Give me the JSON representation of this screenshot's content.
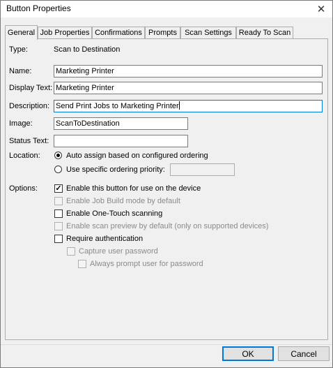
{
  "window": {
    "title": "Button Properties",
    "close_glyph": "✕"
  },
  "tabs": [
    {
      "label": "General",
      "active": true
    },
    {
      "label": "Job Properties"
    },
    {
      "label": "Confirmations"
    },
    {
      "label": "Prompts"
    },
    {
      "label": "Scan Settings"
    },
    {
      "label": "Ready To Scan"
    }
  ],
  "general": {
    "type_label": "Type:",
    "type_value": "Scan to Destination",
    "name_label": "Name:",
    "name_value": "Marketing Printer",
    "display_label": "Display Text:",
    "display_value": "Marketing Printer",
    "description_label": "Description:",
    "description_value": "Send Print Jobs to Marketing Printer",
    "image_label": "Image:",
    "image_value": "ScanToDestination",
    "status_label": "Status Text:",
    "status_value": "",
    "location_label": "Location:",
    "location_auto": "Auto assign based on configured ordering",
    "location_specific": "Use specific ordering priority:",
    "location_priority_value": "",
    "options_label": "Options:",
    "options": [
      {
        "label": "Enable this button for use on the device",
        "checked": true,
        "enabled": true
      },
      {
        "label": "Enable Job Build mode by default",
        "checked": false,
        "enabled": false
      },
      {
        "label": "Enable One-Touch scanning",
        "checked": false,
        "enabled": true
      },
      {
        "label": "Enable scan preview by default (only on supported devices)",
        "checked": false,
        "enabled": false
      },
      {
        "label": "Require authentication",
        "checked": false,
        "enabled": true
      },
      {
        "label": "Capture user password",
        "checked": false,
        "enabled": false
      },
      {
        "label": "Always prompt user for password",
        "checked": false,
        "enabled": false
      }
    ]
  },
  "buttons": {
    "ok": "OK",
    "cancel": "Cancel"
  },
  "check_glyph": "✓"
}
